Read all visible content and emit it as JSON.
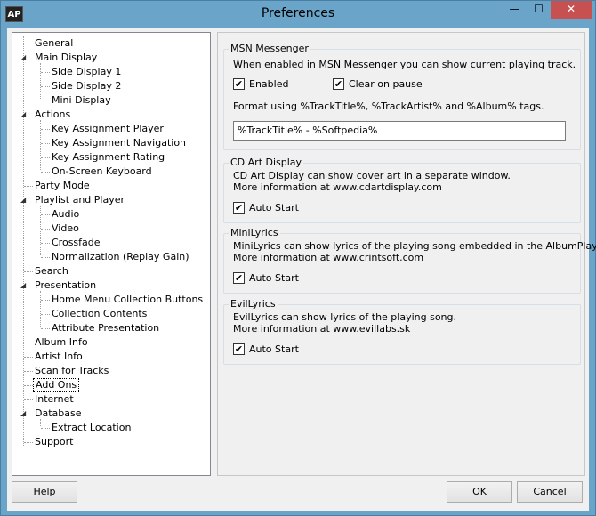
{
  "window": {
    "title": "Preferences",
    "app_icon_text": "AP",
    "min_glyph": "—",
    "max_glyph": "☐",
    "close_glyph": "✕"
  },
  "tree": {
    "items": [
      {
        "label": "General"
      },
      {
        "label": "Main Display"
      },
      {
        "label": "Side Display 1"
      },
      {
        "label": "Side Display 2"
      },
      {
        "label": "Mini Display"
      },
      {
        "label": "Actions"
      },
      {
        "label": "Key Assignment Player"
      },
      {
        "label": "Key Assignment Navigation"
      },
      {
        "label": "Key Assignment Rating"
      },
      {
        "label": "On-Screen Keyboard"
      },
      {
        "label": "Party Mode"
      },
      {
        "label": "Playlist and Player"
      },
      {
        "label": "Audio"
      },
      {
        "label": "Video"
      },
      {
        "label": "Crossfade"
      },
      {
        "label": "Normalization (Replay Gain)"
      },
      {
        "label": "Search"
      },
      {
        "label": "Presentation"
      },
      {
        "label": "Home Menu Collection Buttons"
      },
      {
        "label": "Collection Contents"
      },
      {
        "label": "Attribute Presentation"
      },
      {
        "label": "Album Info"
      },
      {
        "label": "Artist Info"
      },
      {
        "label": "Scan for Tracks"
      },
      {
        "label": "Add Ons"
      },
      {
        "label": "Internet"
      },
      {
        "label": "Database"
      },
      {
        "label": "Extract Location"
      },
      {
        "label": "Support"
      }
    ],
    "expander_glyph": "◢"
  },
  "msn": {
    "title": "MSN Messenger",
    "description": "When enabled in MSN Messenger you can show current playing track.",
    "enabled_label": "Enabled",
    "enabled_checked": "✔",
    "clear_label": "Clear on pause",
    "clear_checked": "✔",
    "format_hint": "Format using %TrackTitle%,  %TrackArtist% and %Album% tags.",
    "format_value": "%TrackTitle% - %Softpedia%"
  },
  "cdart": {
    "title": "CD Art Display",
    "line1": "CD Art Display can show cover art in a separate window.",
    "line2": "More information at www.cdartdisplay.com",
    "autostart_label": "Auto Start",
    "autostart_checked": "✔"
  },
  "minilyrics": {
    "title": "MiniLyrics",
    "line1": "MiniLyrics can show lyrics of the playing song embedded in the AlbumPlayer.",
    "line2": "More information at www.crintsoft.com",
    "autostart_label": "Auto Start",
    "autostart_checked": "✔"
  },
  "evillyrics": {
    "title": "EvilLyrics",
    "line1": "EvilLyrics can show lyrics of the playing song.",
    "line2": "More information at www.evillabs.sk",
    "autostart_label": "Auto Start",
    "autostart_checked": "✔"
  },
  "buttons": {
    "help": "Help",
    "ok": "OK",
    "cancel": "Cancel"
  }
}
